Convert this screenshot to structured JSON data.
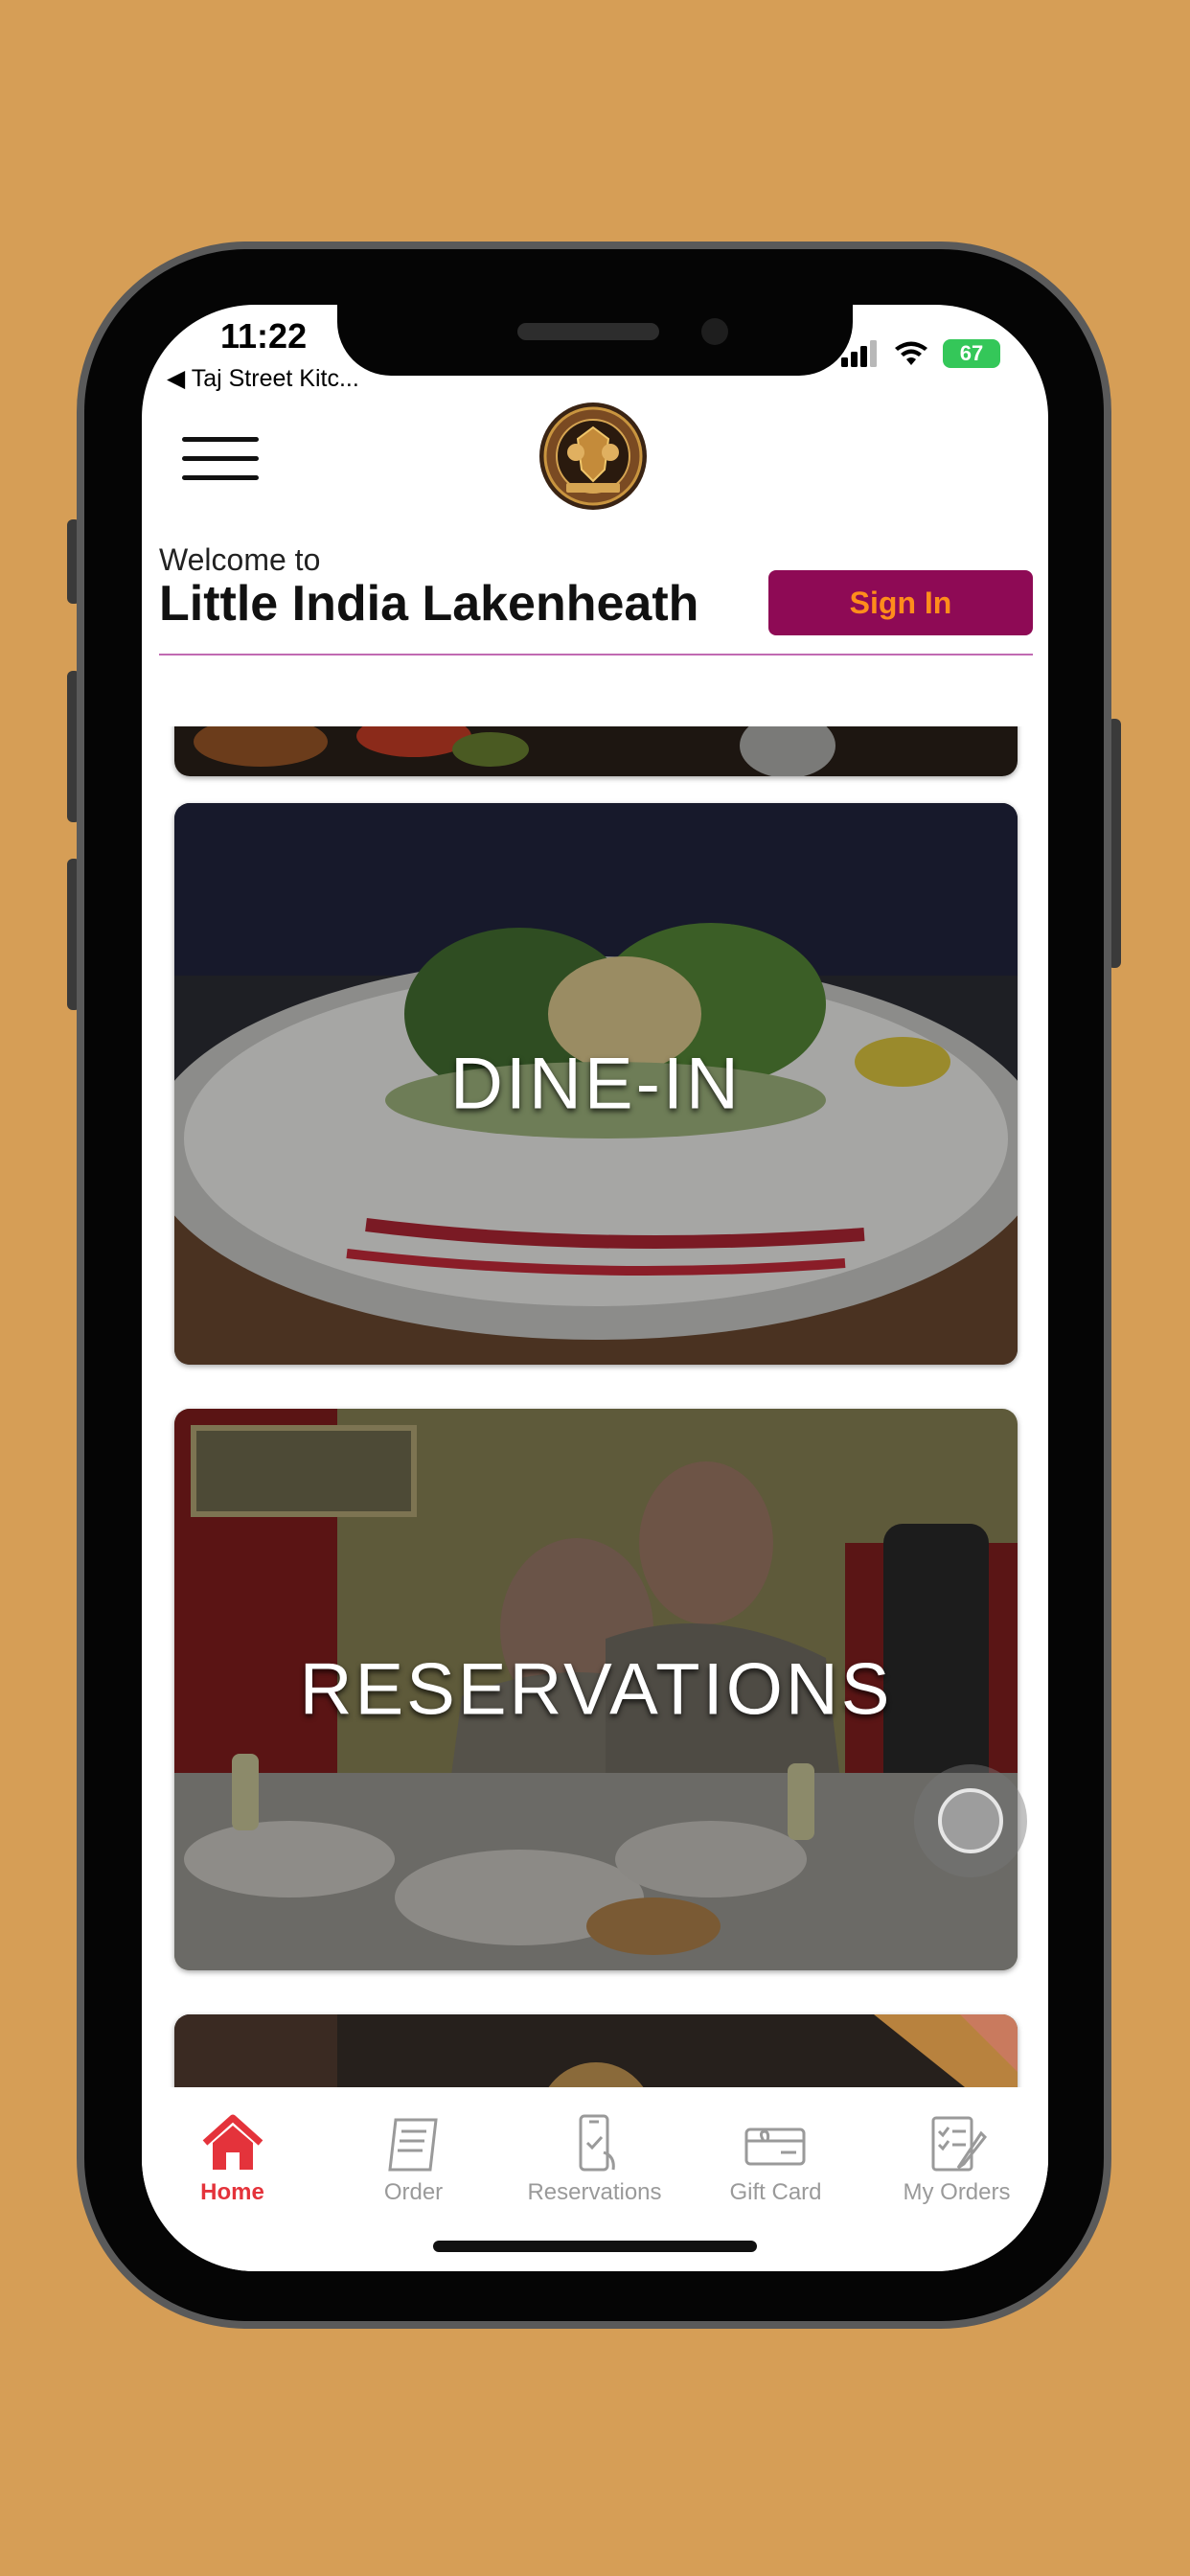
{
  "status_bar": {
    "time": "11:22",
    "back_app": "◀ Taj Street Kitc...",
    "battery": "67"
  },
  "header": {
    "menu_icon": "hamburger-menu-icon",
    "logo_icon": "restaurant-crest-logo",
    "welcome": "Welcome to",
    "restaurant_name": "Little India Lakenheath",
    "sign_in_label": "Sign In"
  },
  "cards": [
    {
      "title": "DINE-IN"
    },
    {
      "title": "RESERVATIONS"
    }
  ],
  "tabs": [
    {
      "label": "Home",
      "icon": "home-icon",
      "active": true
    },
    {
      "label": "Order",
      "icon": "order-receipt-icon",
      "active": false
    },
    {
      "label": "Reservations",
      "icon": "reservations-phone-icon",
      "active": false
    },
    {
      "label": "Gift Card",
      "icon": "gift-card-icon",
      "active": false
    },
    {
      "label": "My Orders",
      "icon": "my-orders-checklist-icon",
      "active": false
    }
  ],
  "colors": {
    "background": "#d69e56",
    "sign_in_bg": "#8e0a55",
    "sign_in_text": "#ff8d1b",
    "active_tab": "#e4333b",
    "divider": "#c16ab2"
  }
}
